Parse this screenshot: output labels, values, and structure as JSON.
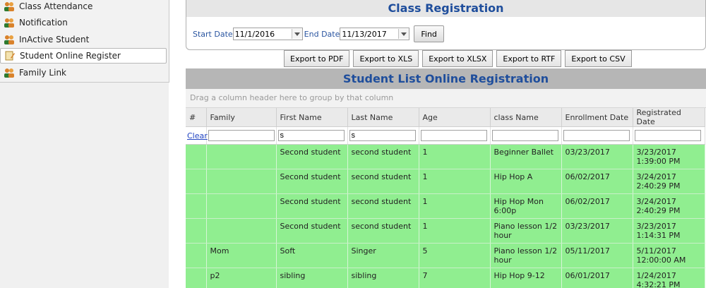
{
  "sidebar": {
    "items": [
      {
        "label": "Class Attendance",
        "icon": "people-icon"
      },
      {
        "label": "Notification",
        "icon": "people-icon"
      },
      {
        "label": "InActive Student",
        "icon": "people-icon"
      },
      {
        "label": "Student Online Register",
        "icon": "register-icon",
        "active": true
      },
      {
        "label": "Family Link",
        "icon": "people-icon"
      }
    ]
  },
  "registration": {
    "title": "Class Registration",
    "start_label": "Start Date",
    "start_value": "11/1/2016",
    "end_label": "End Date",
    "end_value": "11/13/2017",
    "find_label": "Find"
  },
  "export": {
    "pdf": "Export to PDF",
    "xls": "Export to XLS",
    "xlsx": "Export to XLSX",
    "rtf": "Export to RTF",
    "csv": "Export to CSV"
  },
  "grid": {
    "title": "Student List Online Registration",
    "group_hint": "Drag a column header here to group by that column",
    "columns": [
      "#",
      "Family",
      "First Name",
      "Last Name",
      "Age",
      "class Name",
      "Enrollment Date",
      "Registrated Date"
    ],
    "filter": {
      "clear": "Clear",
      "first_name": "s",
      "last_name": "s"
    },
    "rows": [
      [
        "",
        "",
        "Second student",
        "second student",
        "1",
        "Beginner Ballet",
        "03/23/2017",
        "3/23/2017 1:39:00 PM"
      ],
      [
        "",
        "",
        "Second student",
        "second student",
        "1",
        "Hip Hop A",
        "06/02/2017",
        "3/24/2017 2:40:29 PM"
      ],
      [
        "",
        "",
        "Second student",
        "second student",
        "1",
        "Hip Hop Mon 6:00p",
        "06/02/2017",
        "3/24/2017 2:40:29 PM"
      ],
      [
        "",
        "",
        "Second student",
        "second student",
        "1",
        "Piano lesson 1/2 hour",
        "03/23/2017",
        "3/23/2017 1:14:31 PM"
      ],
      [
        "",
        "Mom",
        "Soft",
        "Singer",
        "5",
        "Piano lesson 1/2 hour",
        "05/11/2017",
        "5/11/2017 12:00:00 AM"
      ],
      [
        "",
        "p2",
        "sibling",
        "sibling",
        "7",
        "Hip Hop 9-12",
        "06/01/2017",
        "1/24/2017 4:32:21 PM"
      ]
    ]
  },
  "colors": {
    "accent": "#1f4e9c",
    "row_green": "#90ee90",
    "icon_orange": "#d9822b"
  }
}
